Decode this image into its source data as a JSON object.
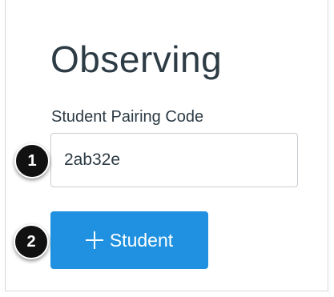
{
  "page": {
    "title": "Observing"
  },
  "pairing": {
    "label": "Student Pairing Code",
    "value": "2ab32e"
  },
  "add_button": {
    "label": "Student",
    "icon": "plus-icon"
  },
  "annotations": {
    "step1": "1",
    "step2": "2"
  },
  "colors": {
    "accent": "#1f91e0",
    "text": "#2d3b45",
    "badge": "#111111"
  }
}
